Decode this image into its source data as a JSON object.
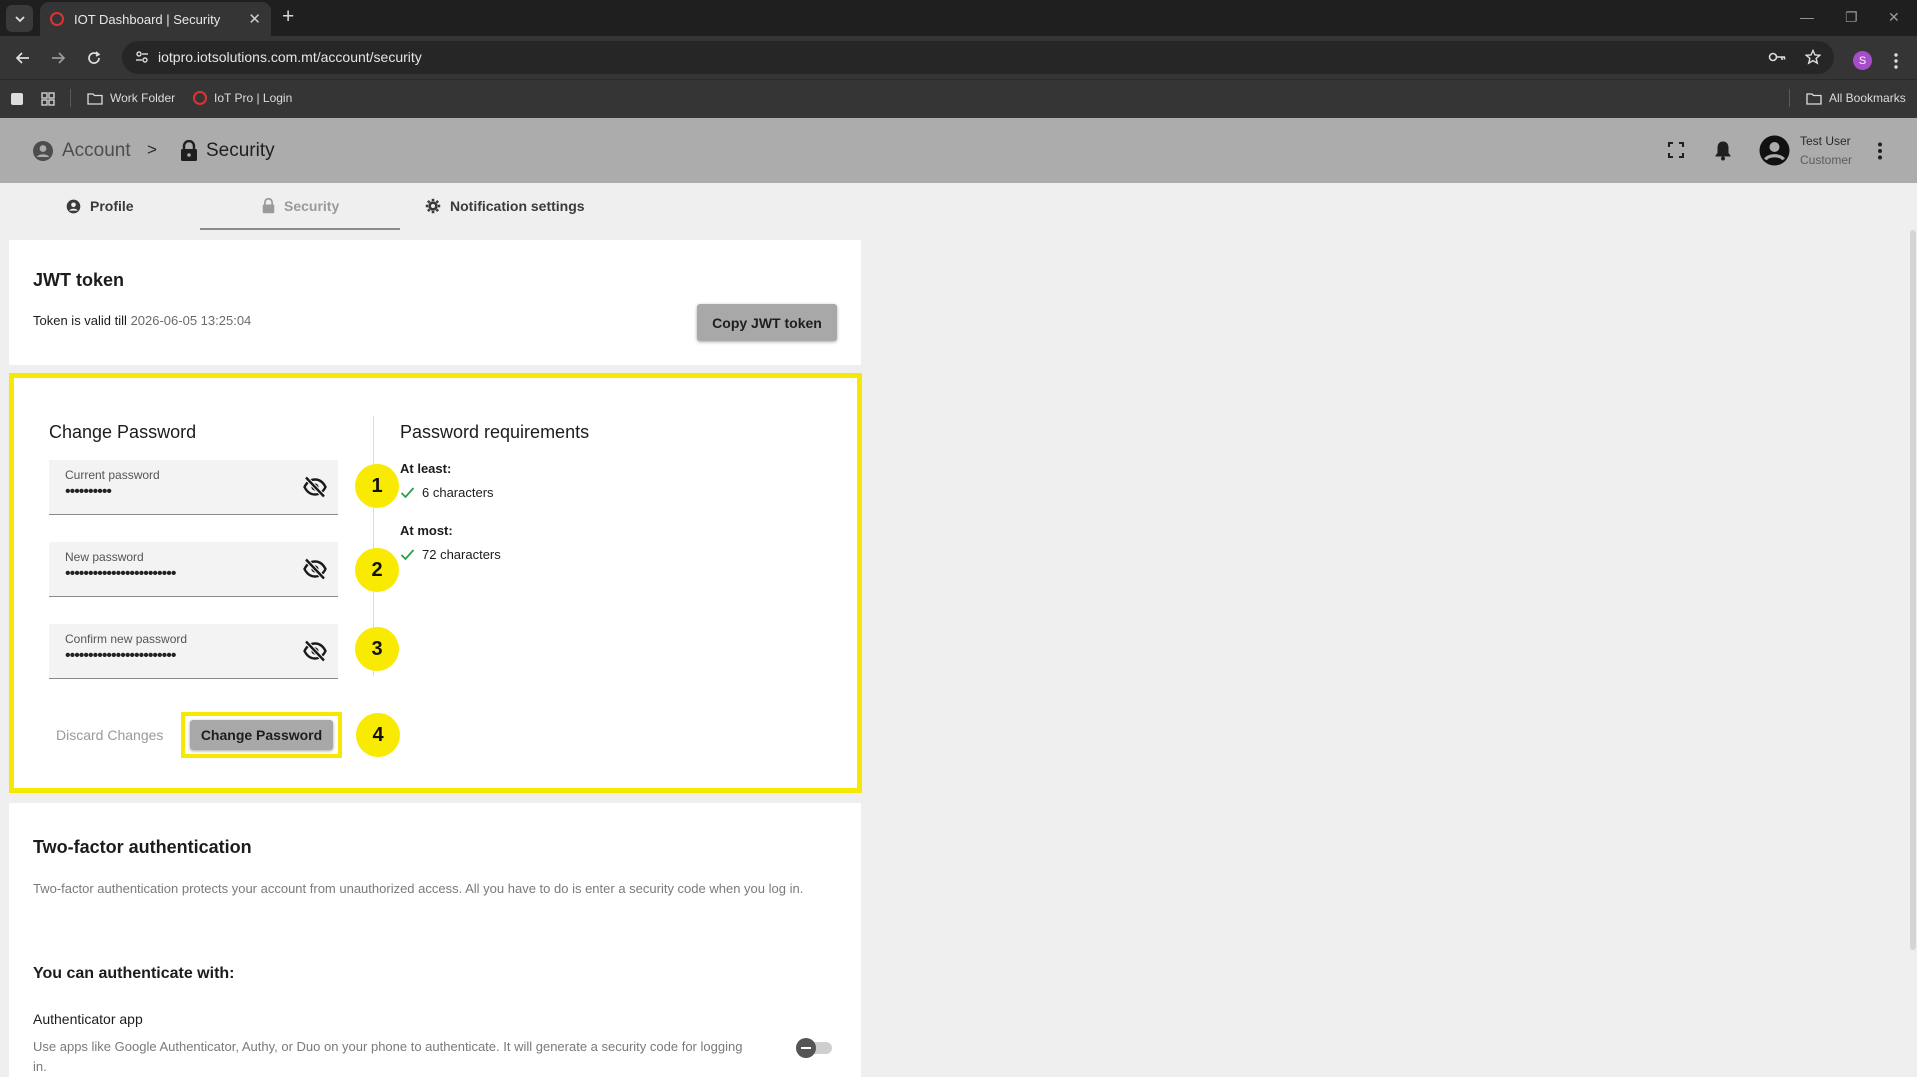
{
  "browser": {
    "tab_title": "IOT Dashboard | Security",
    "url": "iotpro.iotsolutions.com.mt/account/security",
    "profile_initial": "S",
    "bookmarks": [
      {
        "label": "Work Folder"
      },
      {
        "label": "IoT Pro | Login"
      }
    ],
    "all_bookmarks": "All Bookmarks"
  },
  "header": {
    "crumb_account": "Account",
    "crumb_separator": ">",
    "crumb_security": "Security",
    "user_name": "Test User",
    "user_role": "Customer"
  },
  "tabs": [
    {
      "label": "Profile"
    },
    {
      "label": "Security"
    },
    {
      "label": "Notification settings"
    }
  ],
  "jwt": {
    "title": "JWT token",
    "valid_prefix": "Token is valid till",
    "valid_date": "2026-06-05 13:25:04",
    "copy_button": "Copy JWT token"
  },
  "change_password": {
    "title": "Change Password",
    "fields": [
      {
        "label": "Current password",
        "value": "••••••••••",
        "badge": "1"
      },
      {
        "label": "New password",
        "value": "••••••••••••••••••••••••",
        "badge": "2"
      },
      {
        "label": "Confirm new password",
        "value": "••••••••••••••••••••••••",
        "badge": "3"
      }
    ],
    "discard": "Discard Changes",
    "submit": "Change Password",
    "submit_badge": "4"
  },
  "requirements": {
    "title": "Password requirements",
    "at_least_label": "At least:",
    "at_least_item": "6 characters",
    "at_most_label": "At most:",
    "at_most_item": "72 characters"
  },
  "two_factor": {
    "title": "Two-factor authentication",
    "description": "Two-factor authentication protects your account from unauthorized access. All you have to do is enter a security code when you log in.",
    "subtitle": "You can authenticate with:",
    "app_title": "Authenticator app",
    "app_description": "Use apps like Google Authenticator, Authy, or Duo on your phone to authenticate. It will generate a security code for logging in."
  },
  "colors": {
    "highlight": "#f7e800",
    "check": "#2e9d4a",
    "header_bg": "#acacac"
  }
}
